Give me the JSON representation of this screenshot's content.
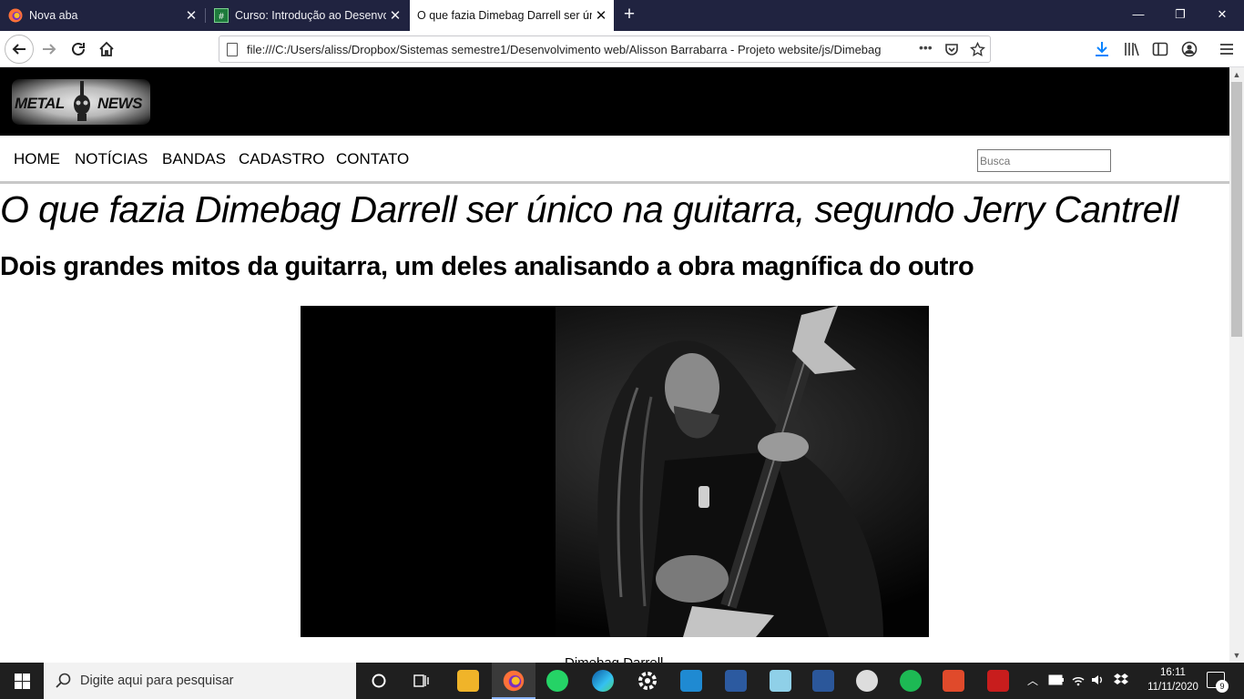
{
  "browser": {
    "tabs": [
      {
        "title": "Nova aba",
        "active": false
      },
      {
        "title": "Curso: Introdução ao Desenvolvimento",
        "active": false
      },
      {
        "title": "O que fazia Dimebag Darrell ser único",
        "active": true
      }
    ],
    "url": "file:///C:/Users/aliss/Dropbox/Sistemas semestre1/Desenvolvimento web/Alisson Barrabarra - Projeto website/js/Dimebag",
    "url_actions_dots": "•••"
  },
  "site": {
    "logo_left": "METAL",
    "logo_right": "NEWS",
    "menu": [
      "HOME",
      "NOTÍCIAS",
      "BANDAS",
      "CADASTRO",
      "CONTATO"
    ],
    "search_placeholder": "Busca"
  },
  "article": {
    "title": "O que fazia Dimebag Darrell ser único na guitarra, segundo Jerry Cantrell",
    "subtitle": "Dois grandes mitos da guitarra, um deles analisando a obra magnífica do outro",
    "caption": "Dimebag Darrell"
  },
  "taskbar": {
    "search_placeholder": "Digite aqui para pesquisar",
    "time": "16:11",
    "date": "11/11/2020",
    "notifications": "9"
  },
  "colors": {
    "titlebar": "#202340",
    "site_header": "#000000",
    "taskbar": "#1f1f1f",
    "download_arrow": "#0a84ff"
  }
}
